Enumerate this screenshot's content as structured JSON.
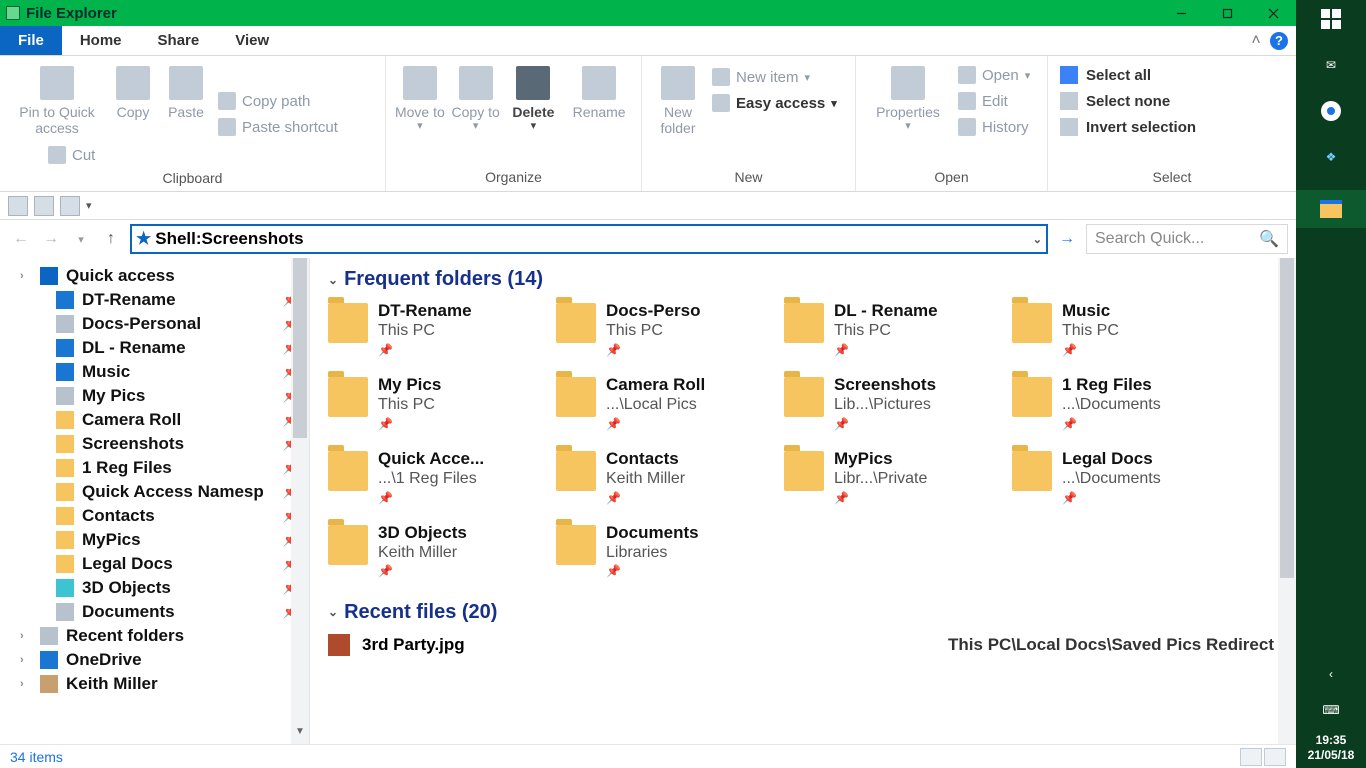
{
  "window": {
    "title": "File Explorer"
  },
  "tabs": {
    "file": "File",
    "home": "Home",
    "share": "Share",
    "view": "View"
  },
  "ribbon": {
    "clipboard": {
      "label": "Clipboard",
      "pin": "Pin to Quick access",
      "copy": "Copy",
      "paste": "Paste",
      "cut": "Cut",
      "copy_path": "Copy path",
      "paste_shortcut": "Paste shortcut"
    },
    "organize": {
      "label": "Organize",
      "move": "Move to",
      "copy": "Copy to",
      "delete": "Delete",
      "rename": "Rename"
    },
    "new": {
      "label": "New",
      "new_folder": "New folder",
      "new_item": "New item",
      "easy_access": "Easy access"
    },
    "open": {
      "label": "Open",
      "properties": "Properties",
      "open": "Open",
      "edit": "Edit",
      "history": "History"
    },
    "select": {
      "label": "Select",
      "all": "Select all",
      "none": "Select none",
      "invert": "Invert selection"
    }
  },
  "address": {
    "value": "Shell:Screenshots"
  },
  "search": {
    "placeholder": "Search Quick..."
  },
  "tree": {
    "items": [
      {
        "label": "Quick access",
        "icon": "pin",
        "expandable": true,
        "indent": 1
      },
      {
        "label": "DT-Rename",
        "icon": "blue",
        "pinned": true,
        "indent": 2
      },
      {
        "label": "Docs-Personal",
        "icon": "doc",
        "pinned": true,
        "indent": 2
      },
      {
        "label": "DL - Rename",
        "icon": "dl",
        "pinned": true,
        "indent": 2
      },
      {
        "label": "Music",
        "icon": "music",
        "pinned": true,
        "indent": 2
      },
      {
        "label": "My Pics",
        "icon": "pic",
        "pinned": true,
        "indent": 2
      },
      {
        "label": "Camera Roll",
        "icon": "folder",
        "pinned": true,
        "indent": 2
      },
      {
        "label": "Screenshots",
        "icon": "folder",
        "pinned": true,
        "indent": 2
      },
      {
        "label": "1 Reg Files",
        "icon": "folder",
        "pinned": true,
        "indent": 2
      },
      {
        "label": "Quick Access Namesp",
        "icon": "folder",
        "pinned": true,
        "indent": 2
      },
      {
        "label": "Contacts",
        "icon": "folder",
        "pinned": true,
        "indent": 2
      },
      {
        "label": "MyPics",
        "icon": "folder",
        "pinned": true,
        "indent": 2
      },
      {
        "label": "Legal Docs",
        "icon": "folder",
        "pinned": true,
        "indent": 2
      },
      {
        "label": "3D Objects",
        "icon": "cyan",
        "pinned": true,
        "indent": 2
      },
      {
        "label": "Documents",
        "icon": "doc",
        "pinned": true,
        "indent": 2
      },
      {
        "label": "Recent folders",
        "icon": "recent",
        "expandable": true,
        "indent": 1
      },
      {
        "label": "OneDrive",
        "icon": "cloud",
        "expandable": true,
        "indent": 1
      },
      {
        "label": "Keith Miller",
        "icon": "user",
        "expandable": true,
        "indent": 1
      }
    ]
  },
  "content": {
    "freq_header": "Frequent folders (14)",
    "recent_header": "Recent files (20)",
    "folders": [
      {
        "name": "DT-Rename",
        "sub": "This PC",
        "pin": true
      },
      {
        "name": "Docs-Perso",
        "sub": "This PC",
        "pin": true
      },
      {
        "name": "DL - Rename",
        "sub": "This PC",
        "pin": true
      },
      {
        "name": "Music",
        "sub": "This PC",
        "pin": true
      },
      {
        "name": "My Pics",
        "sub": "This PC",
        "pin": true
      },
      {
        "name": "Camera Roll",
        "sub": "...\\Local Pics",
        "pin": true
      },
      {
        "name": "Screenshots",
        "sub": "Lib...\\Pictures",
        "pin": true
      },
      {
        "name": "1 Reg Files",
        "sub": "...\\Documents",
        "pin": true
      },
      {
        "name": "Quick Acce...",
        "sub": "...\\1 Reg Files",
        "pin": true
      },
      {
        "name": "Contacts",
        "sub": "Keith Miller",
        "pin": true
      },
      {
        "name": "MyPics",
        "sub": "Libr...\\Private",
        "pin": true
      },
      {
        "name": "Legal Docs",
        "sub": "...\\Documents",
        "pin": true
      },
      {
        "name": "3D Objects",
        "sub": "Keith Miller",
        "pin": true
      },
      {
        "name": "Documents",
        "sub": "Libraries",
        "pin": true
      }
    ],
    "recent": [
      {
        "name": "3rd Party.jpg",
        "path": "This PC\\Local Docs\\Saved Pics Redirect"
      }
    ]
  },
  "status": {
    "text": "34 items"
  },
  "tray": {
    "time": "19:35",
    "date": "21/05/18"
  }
}
